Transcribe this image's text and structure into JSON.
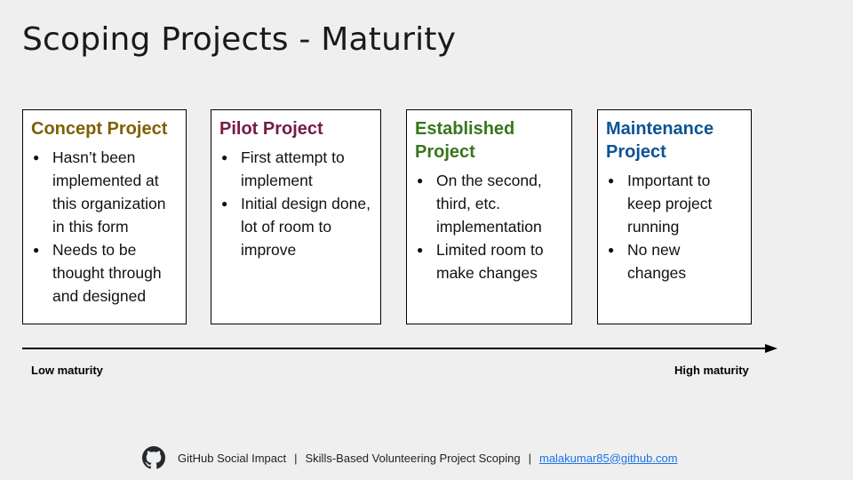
{
  "title": "Scoping Projects - Maturity",
  "colors": {
    "concept": "#7f6000",
    "pilot": "#741b47",
    "established": "#38761d",
    "maintenance": "#0b5394"
  },
  "cards": [
    {
      "title": "Concept Project",
      "bullets": [
        "Hasn’t been implemented at this organization in this form",
        "Needs to be thought through and designed"
      ]
    },
    {
      "title": "Pilot Project",
      "bullets": [
        "First attempt to implement",
        "Initial design done, lot of room to improve"
      ]
    },
    {
      "title": "Established Project",
      "bullets": [
        "On the second, third, etc. implementation",
        "Limited room to make changes"
      ]
    },
    {
      "title": "Maintenance Project",
      "bullets": [
        "Important to keep project running",
        "No new changes"
      ]
    }
  ],
  "axis": {
    "low_label": "Low maturity",
    "high_label": "High maturity"
  },
  "footer": {
    "icon": "github-icon",
    "org": "GitHub Social Impact",
    "separator": "|",
    "subtitle": "Skills-Based Volunteering Project Scoping",
    "email": "malakumar85@github.com"
  }
}
